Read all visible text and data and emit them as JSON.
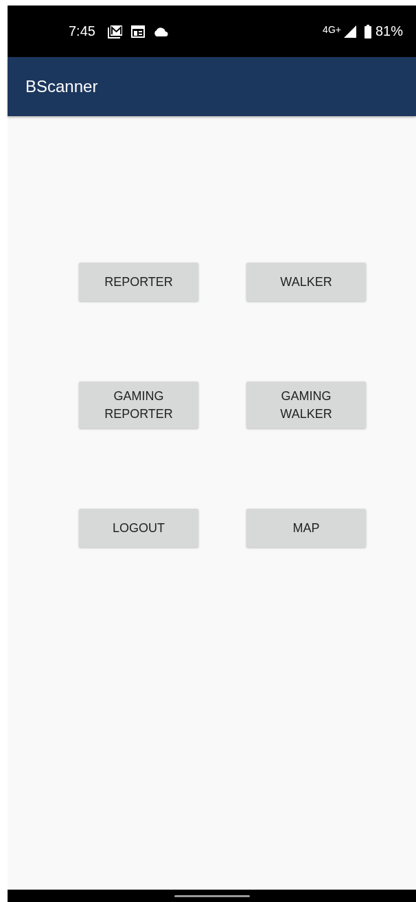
{
  "status_bar": {
    "time": "7:45",
    "network": "4G+",
    "battery": "81%"
  },
  "app_bar": {
    "title": "BScanner"
  },
  "buttons": [
    {
      "label": "REPORTER"
    },
    {
      "label": "WALKER"
    },
    {
      "label": "GAMING REPORTER"
    },
    {
      "label": "GAMING WALKER"
    },
    {
      "label": "LOGOUT"
    },
    {
      "label": "MAP"
    }
  ]
}
